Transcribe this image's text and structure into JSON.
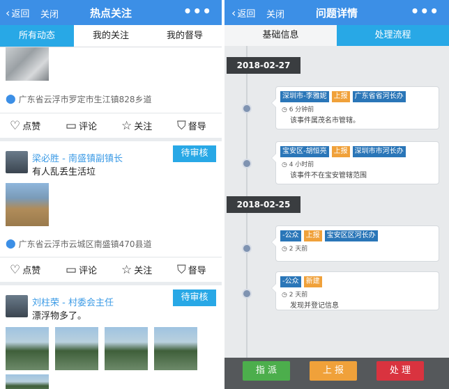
{
  "left": {
    "header": {
      "back_label": "返回",
      "close_label": "关闭",
      "title": "热点关注",
      "more": "•••"
    },
    "tabs": [
      {
        "label": "所有动态",
        "active": true
      },
      {
        "label": "我的关注",
        "active": false
      },
      {
        "label": "我的督导",
        "active": false
      }
    ],
    "actions": {
      "like": "点赞",
      "comment": "评论",
      "follow": "关注",
      "supervise": "督导"
    },
    "posts": [
      {
        "location": "广东省云浮市罗定市生江镇828乡道"
      },
      {
        "author": "梁必胜 - 南盛镇副镇长",
        "status": "待审核",
        "text": "有人乱丢生活垃",
        "location": "广东省云浮市云城区南盛镇470县道"
      },
      {
        "author": "刘柱荣 - 村委会主任",
        "status": "待审核",
        "text": "漂浮物多了。"
      }
    ]
  },
  "right": {
    "header": {
      "back_label": "返回",
      "close_label": "关闭",
      "title": "问题详情",
      "more": "•••"
    },
    "tabs": [
      {
        "label": "基础信息",
        "active": false
      },
      {
        "label": "处理流程",
        "active": true
      }
    ],
    "timeline": [
      {
        "date": "2018-02-27"
      },
      {
        "tags": [
          "深圳市-李雅妮",
          "上报",
          "广东省省河长办"
        ],
        "time": "6 分钟前",
        "note": "该事件属茂名市管辖。"
      },
      {
        "tags": [
          "宝安区-胡恒亮",
          "上报",
          "深圳市市河长办"
        ],
        "time": "4 小时前",
        "note": "该事件不在宝安管辖范围"
      },
      {
        "date": "2018-02-25"
      },
      {
        "tags": [
          "-公众",
          "上报",
          "宝安区区河长办"
        ],
        "time": "2 天前",
        "note": ""
      },
      {
        "tags": [
          "-公众",
          "新建"
        ],
        "time": "2 天前",
        "note": "发现并登记信息"
      }
    ],
    "buttons": {
      "assign": "指 派",
      "report": "上 报",
      "handle": "处 理"
    }
  }
}
